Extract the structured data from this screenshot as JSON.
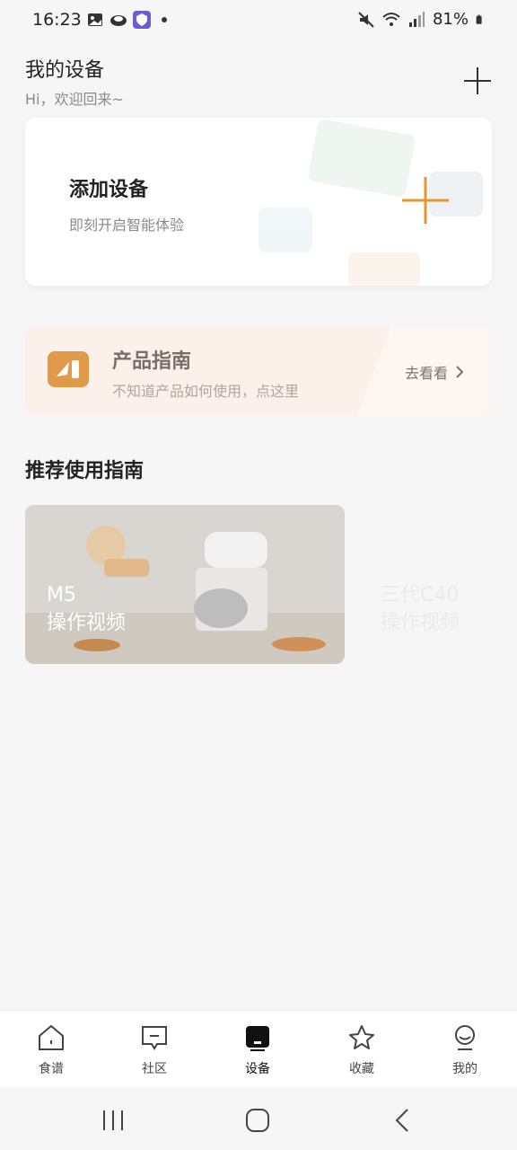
{
  "status_bar": {
    "time": "16:23",
    "battery": "81%"
  },
  "header": {
    "title": "我的设备",
    "subtitle": "Hi，欢迎回来~"
  },
  "add_device": {
    "title": "添加设备",
    "subtitle": "即刻开启智能体验",
    "accent": "#e8952f"
  },
  "guide": {
    "title": "产品指南",
    "subtitle": "不知道产品如何使用，点这里",
    "link": "去看看"
  },
  "recommend": {
    "title": "推荐使用指南",
    "videos": [
      {
        "line1": "M5",
        "line2": "操作视频"
      },
      {
        "line1": "三代C40",
        "line2": "操作视频"
      }
    ]
  },
  "bottom_nav": {
    "items": [
      {
        "label": "食谱",
        "icon": "home-icon"
      },
      {
        "label": "社区",
        "icon": "community-icon"
      },
      {
        "label": "设备",
        "icon": "device-icon",
        "active": true
      },
      {
        "label": "收藏",
        "icon": "star-icon"
      },
      {
        "label": "我的",
        "icon": "profile-icon"
      }
    ]
  }
}
